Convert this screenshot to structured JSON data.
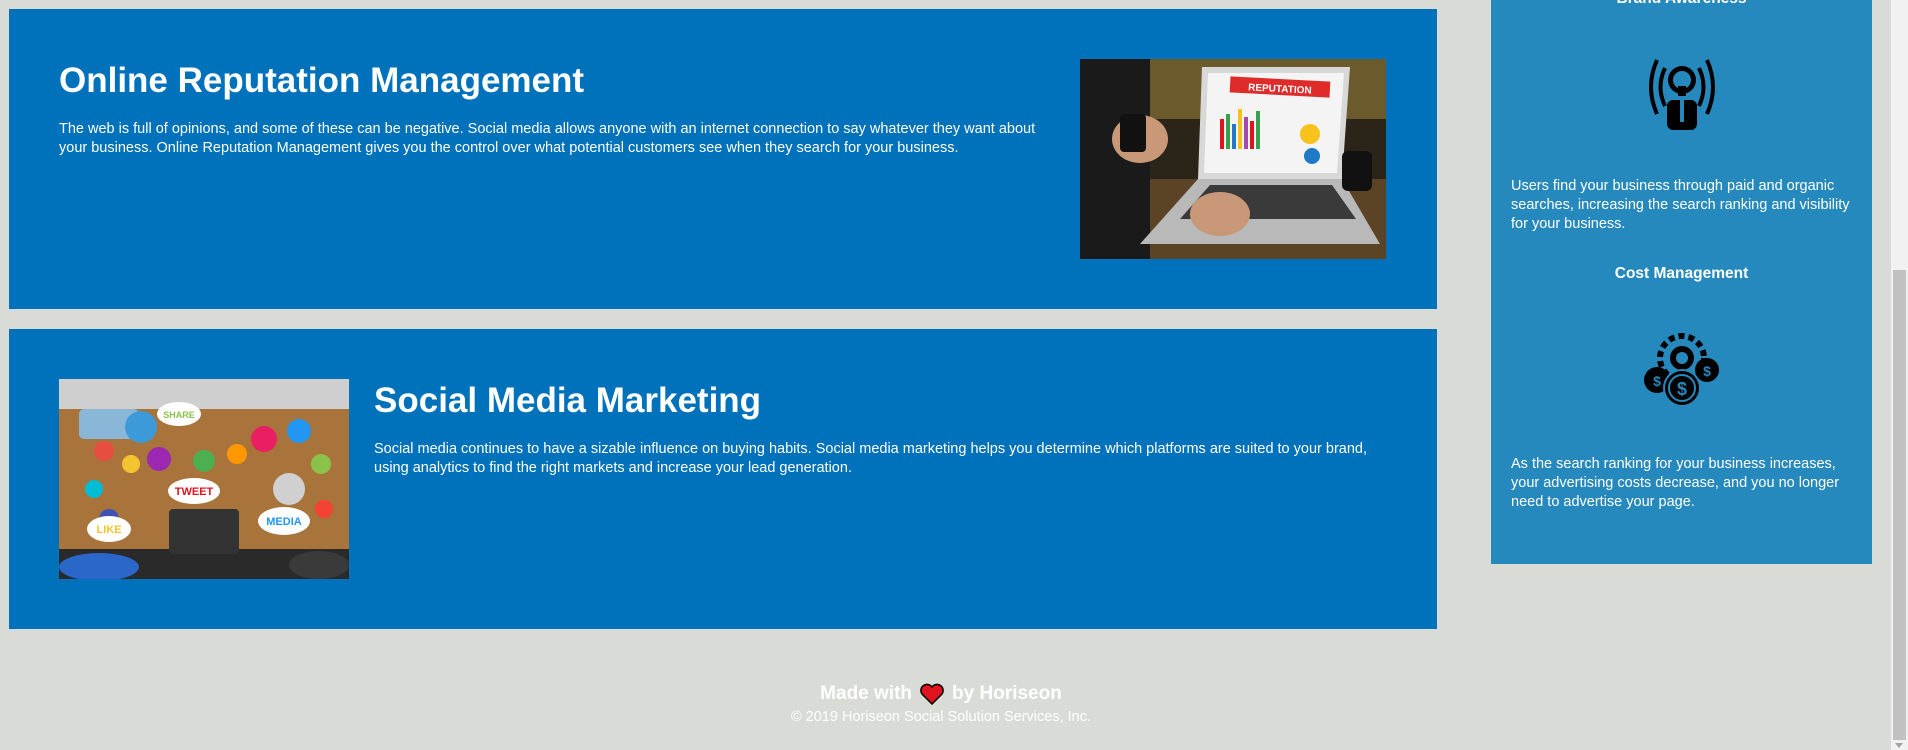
{
  "sections": [
    {
      "title": "Online Reputation Management",
      "text": "The web is full of opinions, and some of these can be negative. Social media allows anyone with an internet connection to say whatever they want about your business. Online Reputation Management gives you the control over what potential customers see when they search for your business.",
      "image_icon": "laptop-reputation-image",
      "image_label": "REPUTATION"
    },
    {
      "title": "Social Media Marketing",
      "text": "Social media continues to have a sizable influence on buying habits. Social media marketing helps you determine which platforms are suited to your brand, using analytics to find the right markets and increase your lead generation.",
      "image_icon": "social-media-collage-image",
      "bubble_tweet": "TWEET",
      "bubble_like": "LIKE",
      "bubble_media": "MEDIA",
      "bubble_share": "SHARE"
    }
  ],
  "sidebar": {
    "brand_title": "Brand Awareness",
    "brand_icon": "lightbulb-broadcast-icon",
    "brand_text": "Users find your business through paid and organic searches, increasing the search ranking and visibility for your business.",
    "cost_title": "Cost Management",
    "cost_icon": "gear-dollar-icon",
    "cost_text": "As the search ranking for your business increases, your advertising costs decrease, and you no longer need to advertise your page."
  },
  "footer": {
    "made_prefix": "Made with",
    "made_suffix": "by Horiseon",
    "heart_icon": "heart-icon",
    "copyright": "© 2019 Horiseon Social Solution Services, Inc."
  },
  "colors": {
    "page_bg": "#d9dcd6",
    "section_bg": "#0072bb",
    "sidebar_bg": "#2589bd",
    "text": "#ffffff",
    "heart": "#e0141e"
  }
}
